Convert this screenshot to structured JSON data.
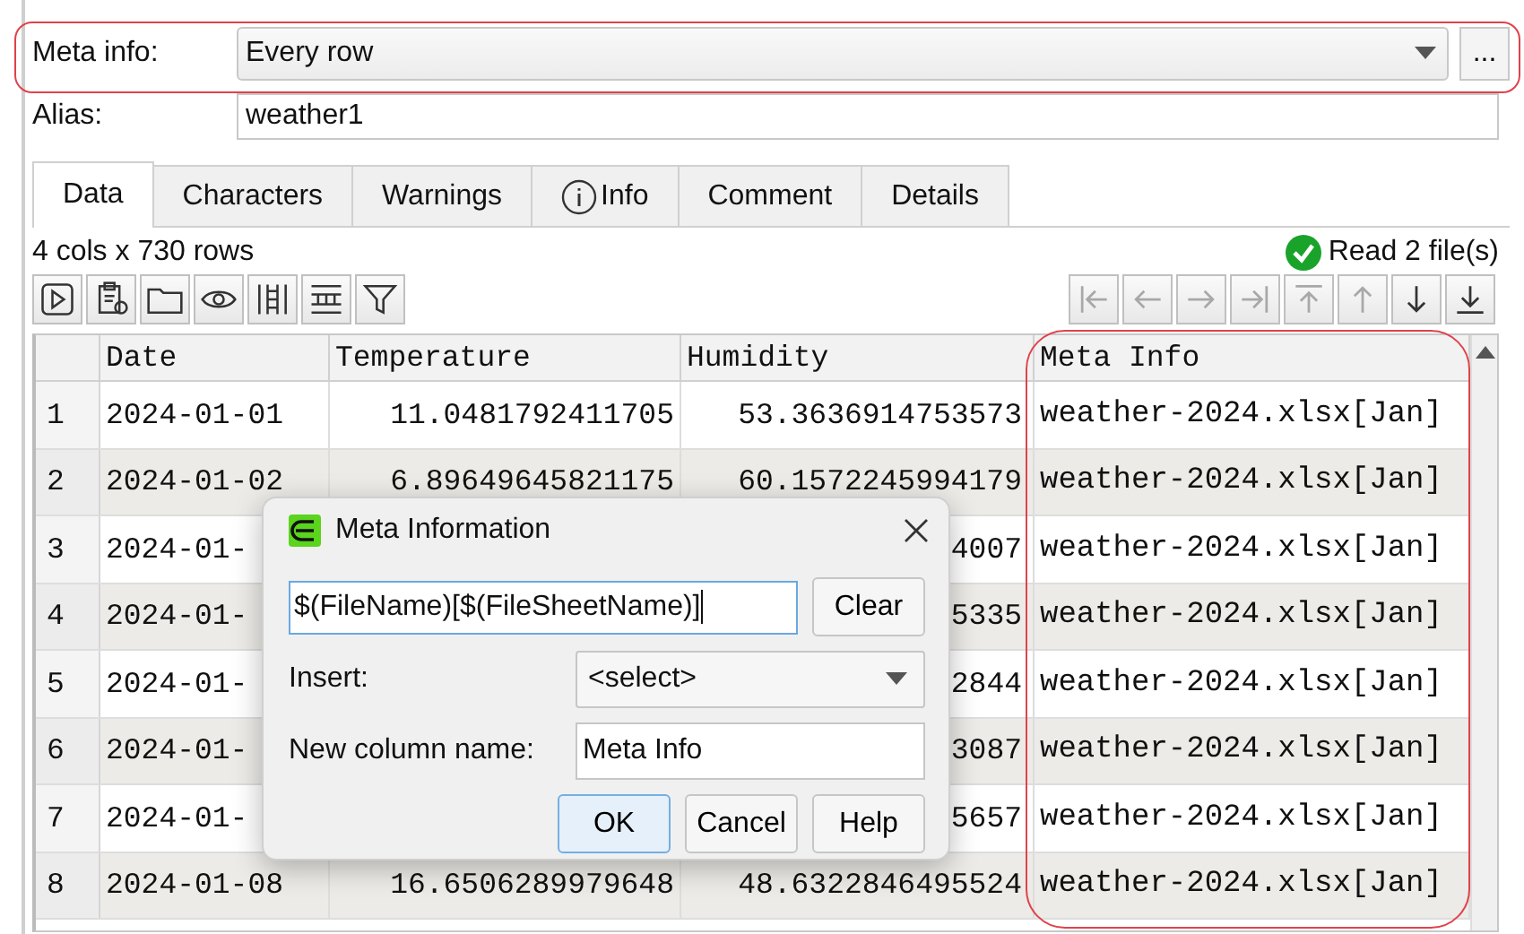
{
  "form": {
    "meta_info": {
      "label": "Meta info:",
      "value": "Every row",
      "more_button": "..."
    },
    "alias": {
      "label": "Alias:",
      "value": "weather1"
    }
  },
  "tabs": [
    {
      "label": "Data",
      "kind": "plain",
      "selected": true
    },
    {
      "label": "Characters",
      "kind": "plain",
      "selected": false
    },
    {
      "label": "Warnings",
      "kind": "plain",
      "selected": false
    },
    {
      "label": "Info",
      "kind": "info",
      "selected": false
    },
    {
      "label": "Comment",
      "kind": "plain",
      "selected": false
    },
    {
      "label": "Details",
      "kind": "plain",
      "selected": false
    }
  ],
  "summary": "4 cols x 730 rows",
  "status": {
    "text": "Read 2 file(s)",
    "ok": true
  },
  "nav_buttons": [
    {
      "kind": "first",
      "disabled": true
    },
    {
      "kind": "prev",
      "disabled": true
    },
    {
      "kind": "next",
      "disabled": true
    },
    {
      "kind": "last",
      "disabled": true
    },
    {
      "kind": "top",
      "disabled": true
    },
    {
      "kind": "up",
      "disabled": true
    },
    {
      "kind": "down",
      "disabled": false
    },
    {
      "kind": "bottom",
      "disabled": false
    }
  ],
  "table": {
    "columns": [
      "Date",
      "Temperature",
      "Humidity",
      "Meta Info"
    ],
    "rows": [
      {
        "number": "1",
        "date": "2024-01-01",
        "temperature": "11.0481792411705",
        "humidity": "53.3636914753573",
        "meta_info": "weather-2024.xlsx[Jan]"
      },
      {
        "number": "2",
        "date": "2024-01-02",
        "temperature": "6.89649645821175",
        "humidity": "60.1572245994179",
        "meta_info": "weather-2024.xlsx[Jan]"
      },
      {
        "number": "3",
        "date": "2024-01-",
        "humidity": "4007",
        "meta_info": "weather-2024.xlsx[Jan]"
      },
      {
        "number": "4",
        "date": "2024-01-",
        "humidity": "5335",
        "meta_info": "weather-2024.xlsx[Jan]"
      },
      {
        "number": "5",
        "date": "2024-01-",
        "humidity": "2844",
        "meta_info": "weather-2024.xlsx[Jan]"
      },
      {
        "number": "6",
        "date": "2024-01-",
        "humidity": "3087",
        "meta_info": "weather-2024.xlsx[Jan]"
      },
      {
        "number": "7",
        "date": "2024-01-",
        "humidity": "5657",
        "meta_info": "weather-2024.xlsx[Jan]"
      },
      {
        "number": "8",
        "date": "2024-01-08",
        "temperature": "16.6506289979648",
        "humidity": "48.6322846495524",
        "meta_info": "weather-2024.xlsx[Jan]"
      }
    ]
  },
  "dialog": {
    "title": "Meta Information",
    "expression": "$(FileName)[$(FileSheetName)]",
    "clear_button": "Clear",
    "insert_label": "Insert:",
    "insert_value": "<select>",
    "column_name_label": "New column name:",
    "column_name_value": "Meta Info",
    "buttons": [
      {
        "label": "OK",
        "default": true
      },
      {
        "label": "Cancel",
        "default": false
      },
      {
        "label": "Help",
        "default": false
      }
    ]
  }
}
